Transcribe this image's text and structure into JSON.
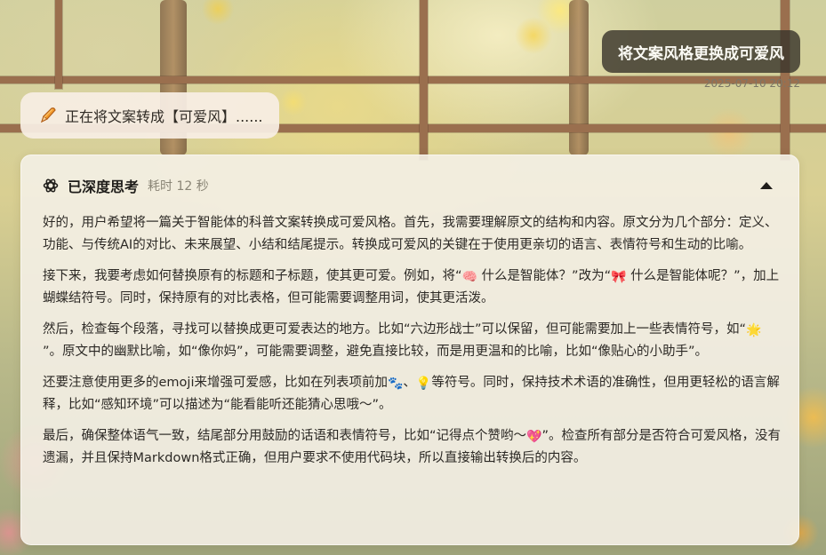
{
  "user_message": {
    "text": "将文案风格更换成可爱风",
    "timestamp": "2025-07-10 20:12"
  },
  "status": {
    "icon": "pencil-icon",
    "text": "正在将文案转成【可爱风】......"
  },
  "thinking": {
    "icon": "brain-icon",
    "title": "已深度思考",
    "duration": "耗时 12 秒",
    "collapse_icon": "caret-up-icon",
    "paragraphs": [
      {
        "p1": "好的，用户希望将一篇关于智能体的科普文案转换成可爱风格。首先，我需要理解原文的结构和内容。原文分为几个部分：定义、功能、与传统AI的对比、未来展望、小结和结尾提示。转换成可爱风的关键在于使用更亲切的语言、表情符号和生动的比喻。"
      },
      {
        "p1": "接下来，我要考虑如何替换原有的标题和子标题，使其更可爱。例如，将“",
        "e1": "🧠",
        "p2": " 什么是智能体？”改为“",
        "e2": "🎀",
        "p3": " 什么是智能体呢？”，加上蝴蝶结符号。同时，保持原有的对比表格，但可能需要调整用词，使其更活泼。"
      },
      {
        "p1": "然后，检查每个段落，寻找可以替换成更可爱表达的地方。比如“六边形战士”可以保留，但可能需要加上一些表情符号，如“",
        "e1": "🌟",
        "p2": "”。原文中的幽默比喻，如“像你妈”，可能需要调整，避免直接比较，而是用更温和的比喻，比如“像贴心的小助手”。"
      },
      {
        "p1": "还要注意使用更多的emoji来增强可爱感，比如在列表项前加",
        "e1": "🐾",
        "p2": "、",
        "e2": "💡",
        "p3": "等符号。同时，保持技术术语的准确性，但用更轻松的语言解释，比如“感知环境”可以描述为“能看能听还能猜心思哦～”。"
      },
      {
        "p1": "最后，确保整体语气一致，结尾部分用鼓励的话语和表情符号，比如“记得点个赞哟～",
        "e1": "💖",
        "p2": "”。检查所有部分是否符合可爱风格，没有遗漏，并且保持Markdown格式正确，但用户要求不使用代码块，所以直接输出转换后的内容。"
      }
    ]
  },
  "colors": {
    "user_bubble_bg": "#3a362c",
    "panel_bg": "#f4f0e5",
    "text": "#2c2925",
    "muted": "#8a8576"
  }
}
